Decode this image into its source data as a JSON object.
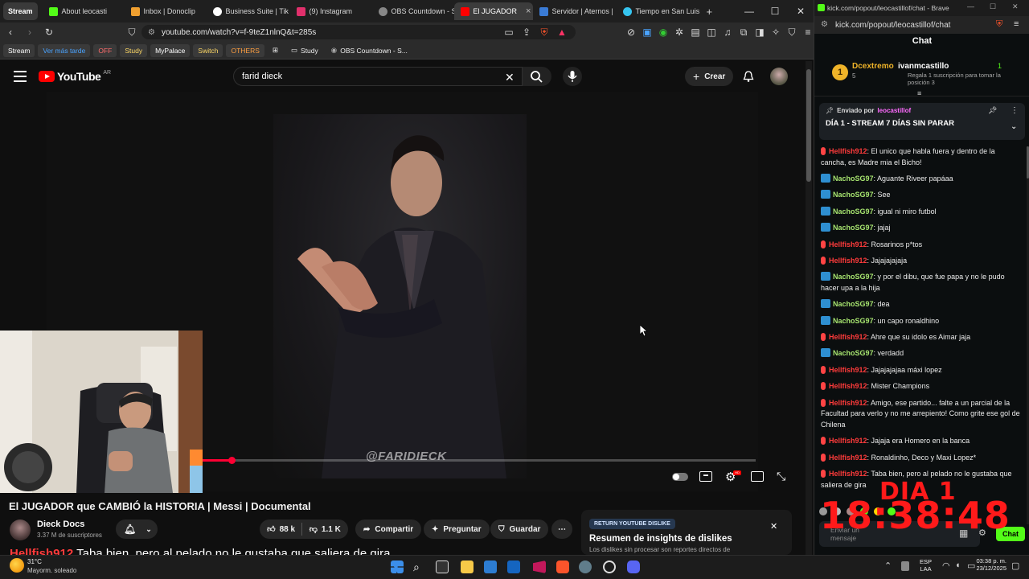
{
  "left_browser": {
    "tabs": [
      {
        "label": "Stream",
        "pinned": true,
        "color": "#3a3a3a"
      },
      {
        "label": "About leocasti",
        "color": "#53fc18"
      },
      {
        "label": "Inbox | Donoclip",
        "color": "#f0a030"
      },
      {
        "label": "Business Suite | Tik",
        "color": "#ffffff"
      },
      {
        "label": "(9) Instagram",
        "color": "#e1306c"
      },
      {
        "label": "OBS Countdown - S",
        "color": "#888888"
      },
      {
        "label": "El JUGADOR",
        "color": "#ff0000",
        "active": true
      },
      {
        "label": "Servidor | Aternos |",
        "color": "#3a7bd5"
      },
      {
        "label": "Tiempo en San Luis",
        "color": "#36c5f0"
      }
    ],
    "url": "youtube.com/watch?v=f-9teZ1nlnQ&t=285s",
    "bookmarks": [
      {
        "label": "Stream",
        "color": "#ffffff"
      },
      {
        "label": "Ver más tarde",
        "color": "#4aa3ff"
      },
      {
        "label": "OFF",
        "color": "#ff6b6b"
      },
      {
        "label": "Study",
        "color": "#ffd966"
      },
      {
        "label": "MyPalace",
        "color": "#ffffff"
      },
      {
        "label": "Switch",
        "color": "#ffd966"
      },
      {
        "label": "OTHERS",
        "color": "#ff9f40"
      },
      {
        "label": "Study",
        "color": "#ffffff",
        "folder": true
      },
      {
        "label": "OBS Countdown - S...",
        "color": "#ffffff",
        "folder": true
      }
    ]
  },
  "youtube": {
    "logo": "YouTube",
    "region": "AR",
    "search_value": "farid dieck",
    "create_label": "Crear",
    "watermark": "@FARIDIECK",
    "progress": 0.05,
    "video_title": "El JUGADOR que CAMBIÓ la HISTORIA | Messi | Documental",
    "channel_name": "Dieck Docs",
    "subscribers": "3.37 M de suscriptores",
    "likes": "88 k",
    "dislikes": "1.1 K",
    "share_label": "Compartir",
    "ask_label": "Preguntar",
    "save_label": "Guardar",
    "dislike_card": {
      "tag": "RETURN YOUTUBE DISLIKE",
      "title": "Resumen de insights de dislikes",
      "desc": "Los dislikes sin procesar son reportes directos de"
    }
  },
  "overlay_chat": {
    "user": "Hellfish912",
    "text": "Taba bien, pero al pelado no le gustaba que saliera de gira",
    "user_color": "#ff3b3b"
  },
  "kick": {
    "tab_title": "kick.com/popout/leocastillof/chat - Brave",
    "url": "kick.com/popout/leocastillof/chat",
    "chat_title": "Chat",
    "leader": {
      "rank": "1",
      "name": "Dcextremo",
      "points": "5",
      "gifter": "ivanmcastillo",
      "gift_count": "1",
      "gift_text": "Regala 1 suscripción para tomar la posición 3"
    },
    "pinned": {
      "sent_by_label": "Enviado por",
      "sender": "leocastillof",
      "text": "DÍA 1 - STREAM 7 DÍAS SIN PARAR"
    },
    "messages": [
      {
        "user": "Hellfish912",
        "text": "El unico que habla fuera y dentro de la cancha, es Madre mia el Bicho!",
        "color": "#ff3b3b",
        "badge": "red"
      },
      {
        "user": "NachoSG97",
        "text": "Aguante Riveer papáaa",
        "color": "#a6e36f",
        "badge": "blue"
      },
      {
        "user": "NachoSG97",
        "text": "See",
        "color": "#a6e36f",
        "badge": "blue"
      },
      {
        "user": "NachoSG97",
        "text": "igual ni miro futbol",
        "color": "#a6e36f",
        "badge": "blue"
      },
      {
        "user": "NachoSG97",
        "text": "jajaj",
        "color": "#a6e36f",
        "badge": "blue"
      },
      {
        "user": "Hellfish912",
        "text": "Rosarinos p*tos",
        "color": "#ff3b3b",
        "badge": "red"
      },
      {
        "user": "Hellfish912",
        "text": "Jajajajajaja",
        "color": "#ff3b3b",
        "badge": "red"
      },
      {
        "user": "NachoSG97",
        "text": "y por el dibu, que fue papa y no le pudo hacer upa a la hija",
        "color": "#a6e36f",
        "badge": "blue"
      },
      {
        "user": "NachoSG97",
        "text": "dea",
        "color": "#a6e36f",
        "badge": "blue"
      },
      {
        "user": "NachoSG97",
        "text": "un capo ronaldhino",
        "color": "#a6e36f",
        "badge": "blue"
      },
      {
        "user": "Hellfish912",
        "text": "Ahre que su idolo es Aimar jaja",
        "color": "#ff3b3b",
        "badge": "red"
      },
      {
        "user": "NachoSG97",
        "text": "verdadd",
        "color": "#a6e36f",
        "badge": "blue"
      },
      {
        "user": "Hellfish912",
        "text": "Jajajajajaa máxi lopez",
        "color": "#ff3b3b",
        "badge": "red"
      },
      {
        "user": "Hellfish912",
        "text": "Mister Champions",
        "color": "#ff3b3b",
        "badge": "red"
      },
      {
        "user": "Hellfish912",
        "text": "Amigo, ese partido... falte a un parcial de la Facultad para verlo y no me arrepiento! Como grite ese gol de Chilena",
        "color": "#ff3b3b",
        "badge": "red"
      },
      {
        "user": "Hellfish912",
        "text": "Jajaja era Homero en la banca",
        "color": "#ff3b3b",
        "badge": "red"
      },
      {
        "user": "Hellfish912",
        "text": "Ronaldinho, Deco y Maxi Lopez*",
        "color": "#ff3b3b",
        "badge": "red"
      },
      {
        "user": "Hellfish912",
        "text": "Taba bien, pero al pelado no le gustaba que saliera de gira",
        "color": "#ff3b3b",
        "badge": "red"
      }
    ],
    "input_placeholder": "Enviar un mensaje",
    "send_label": "Chat"
  },
  "timer": {
    "day": "DIA 1",
    "time": "18:38:48"
  },
  "taskbar": {
    "weather_temp": "31°C",
    "weather_desc": "Mayorm. soleado",
    "lang_top": "ESP",
    "lang_bottom": "LAA",
    "time": "03:38 p. m.",
    "date": "23/12/2025"
  }
}
